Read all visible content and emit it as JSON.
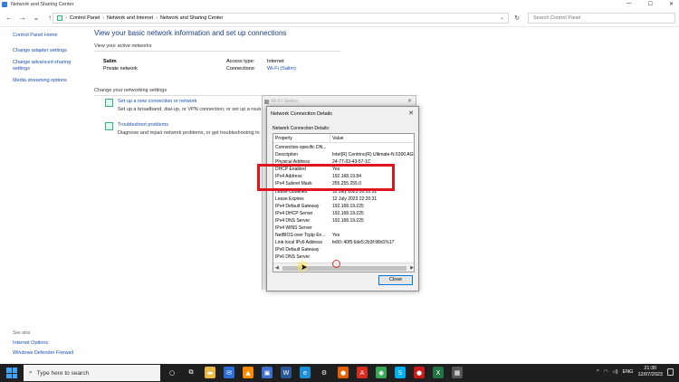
{
  "window": {
    "title": "Network and Sharing Center",
    "minimize": "—",
    "maximize": "☐",
    "close": "✕"
  },
  "addressbar": {
    "back": "←",
    "forward": "→",
    "recent": "⌄",
    "up": "↑",
    "crumbs": [
      "Control Panel",
      "Network and Internet",
      "Network and Sharing Center"
    ],
    "separator": "›",
    "dropdown": "⌄",
    "refresh": "↻",
    "search_placeholder": "Search Control Panel"
  },
  "left_panel": {
    "home": "Control Panel Home",
    "items": [
      "Change adapter settings",
      "Change advanced sharing settings",
      "Media streaming options"
    ],
    "see_also": "See also",
    "see_also_items": [
      "Internet Options",
      "Windows Defender Firewall"
    ]
  },
  "main": {
    "title": "View your basic network information and set up connections",
    "active_networks_label": "View your active networks",
    "network_name": "Salim",
    "network_type": "Private network",
    "access_type_label": "Access type:",
    "access_type_value": "Internet",
    "connections_label": "Connections:",
    "connections_value": "Wi-Fi (Salim)",
    "change_settings_label": "Change your networking settings",
    "tasks": [
      {
        "title": "Set up a new connection or network",
        "desc": "Set up a broadband, dial-up, or VPN connection; or set up a route"
      },
      {
        "title": "Troubleshoot problems",
        "desc": "Diagnose and repair network problems, or get troubleshooting in"
      }
    ]
  },
  "wifi_status": {
    "title": "Wi-Fi Status",
    "close": "✕"
  },
  "details_dialog": {
    "title": "Network Connection Details",
    "close": "✕",
    "label": "Network Connection Details:",
    "col_property": "Property",
    "col_value": "Value",
    "rows": [
      {
        "prop": "Connection-specific DN...",
        "val": ""
      },
      {
        "prop": "Description",
        "val": "Intel(R) Centrino(R) Ultimate-N 6300 AGN"
      },
      {
        "prop": "Physical Address",
        "val": "24-77-03-43-57-1C"
      },
      {
        "prop": "DHCP Enabled",
        "val": "Yes"
      },
      {
        "prop": "IPv4 Address",
        "val": "192.168.19.84"
      },
      {
        "prop": "IPv4 Subnet Mask",
        "val": "255.255.255.0"
      },
      {
        "prop": "Lease Obtained",
        "val": "12 July 2023 20:20:31"
      },
      {
        "prop": "Lease Expires",
        "val": "12 July 2023 22:20:31"
      },
      {
        "prop": "IPv4 Default Gateway",
        "val": "192.168.19.225"
      },
      {
        "prop": "IPv4 DHCP Server",
        "val": "192.168.19.225"
      },
      {
        "prop": "IPv4 DNS Server",
        "val": "192.168.19.225"
      },
      {
        "prop": "IPv4 WINS Server",
        "val": ""
      },
      {
        "prop": "NetBIOS over Tcpip En...",
        "val": "Yes"
      },
      {
        "prop": "Link-local IPv6 Address",
        "val": "fe80::40f5:6de5:2b3f:98d1%17"
      },
      {
        "prop": "IPv6 Default Gateway",
        "val": ""
      },
      {
        "prop": "IPv6 DNS Server",
        "val": ""
      }
    ],
    "scroll_left": "◀",
    "scroll_right": "▶",
    "close_button": "Close"
  },
  "taskbar": {
    "search_placeholder": "Type here to search",
    "apps": [
      {
        "icon": "cortana-icon",
        "glyph": "○",
        "color": "transparent"
      },
      {
        "icon": "task-view-icon",
        "glyph": "⧉",
        "color": "transparent"
      },
      {
        "icon": "file-explorer-icon",
        "glyph": "▬",
        "color": "#e8b84a"
      },
      {
        "icon": "mail-icon",
        "glyph": "✉",
        "color": "#2a6fd6"
      },
      {
        "icon": "vlc-icon",
        "glyph": "▲",
        "color": "#ff8a00"
      },
      {
        "icon": "store-icon",
        "glyph": "▣",
        "color": "#3c6fd0"
      },
      {
        "icon": "word-icon",
        "glyph": "W",
        "color": "#2b579a"
      },
      {
        "icon": "edge-icon",
        "glyph": "e",
        "color": "#1c8fd8"
      },
      {
        "icon": "settings-icon",
        "glyph": "⚙",
        "color": "transparent"
      },
      {
        "icon": "firefox-icon",
        "glyph": "●",
        "color": "#e66000"
      },
      {
        "icon": "acrobat-icon",
        "glyph": "A",
        "color": "#d62d20"
      },
      {
        "icon": "chrome-icon",
        "glyph": "◉",
        "color": "#34a853"
      },
      {
        "icon": "skype-icon",
        "glyph": "S",
        "color": "#00aff0"
      },
      {
        "icon": "record-icon",
        "glyph": "●",
        "color": "#cc1a1a"
      },
      {
        "icon": "excel-icon",
        "glyph": "X",
        "color": "#217346"
      },
      {
        "icon": "app-icon",
        "glyph": "▦",
        "color": "#555555"
      }
    ],
    "tray_expand": "^",
    "language": "ENG",
    "time": "21:30",
    "date": "12/07/2023"
  },
  "colors": {
    "link": "#1a4fb4",
    "title_blue": "#1e3f87",
    "annotation_red": "#e0141c",
    "taskbar": "#1f1f1f"
  }
}
